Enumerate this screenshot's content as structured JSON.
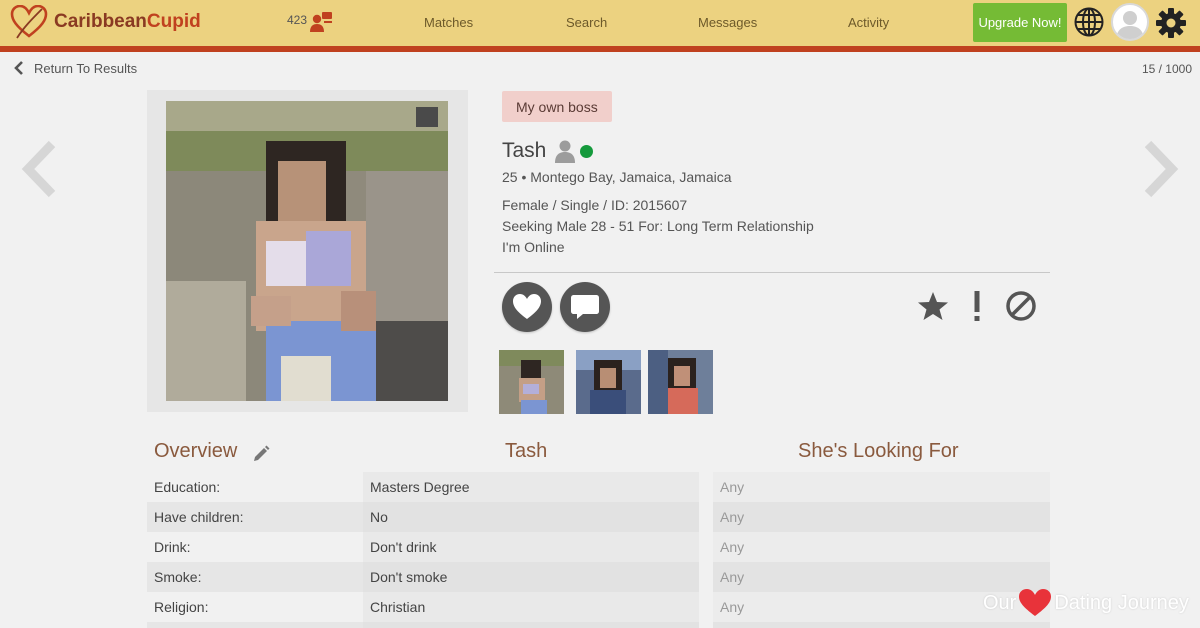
{
  "brand": {
    "name_part1": "Caribbean",
    "name_part2": "Cupid",
    "primary_color": "#c0411f",
    "header_color": "#ecd280"
  },
  "header": {
    "notification_count": "423",
    "nav": [
      "Matches",
      "Search",
      "Messages",
      "Activity"
    ],
    "upgrade_label": "Upgrade Now!"
  },
  "subbar": {
    "back_label": "Return To Results",
    "counter": "15 / 1000"
  },
  "profile": {
    "tag": "My own boss",
    "name": "Tash",
    "online_color": "#159a3c",
    "location": "25 • Montego Bay, Jamaica, Jamaica",
    "details": "Female / Single / ID: 2015607",
    "seeking": "Seeking Male 28 - 51 For: Long Term Relationship",
    "status": "I'm Online"
  },
  "table": {
    "overview_title": "Overview",
    "person_title": "Tash",
    "looking_title": "She's Looking For",
    "rows": [
      {
        "label": "Education:",
        "value": "Masters Degree",
        "looking": "Any"
      },
      {
        "label": "Have children:",
        "value": "No",
        "looking": "Any"
      },
      {
        "label": "Drink:",
        "value": "Don't drink",
        "looking": "Any"
      },
      {
        "label": "Smoke:",
        "value": "Don't smoke",
        "looking": "Any"
      },
      {
        "label": "Religion:",
        "value": "Christian",
        "looking": "Any"
      }
    ]
  },
  "watermark": {
    "part1": "Our",
    "part2": "Dating Journey"
  }
}
